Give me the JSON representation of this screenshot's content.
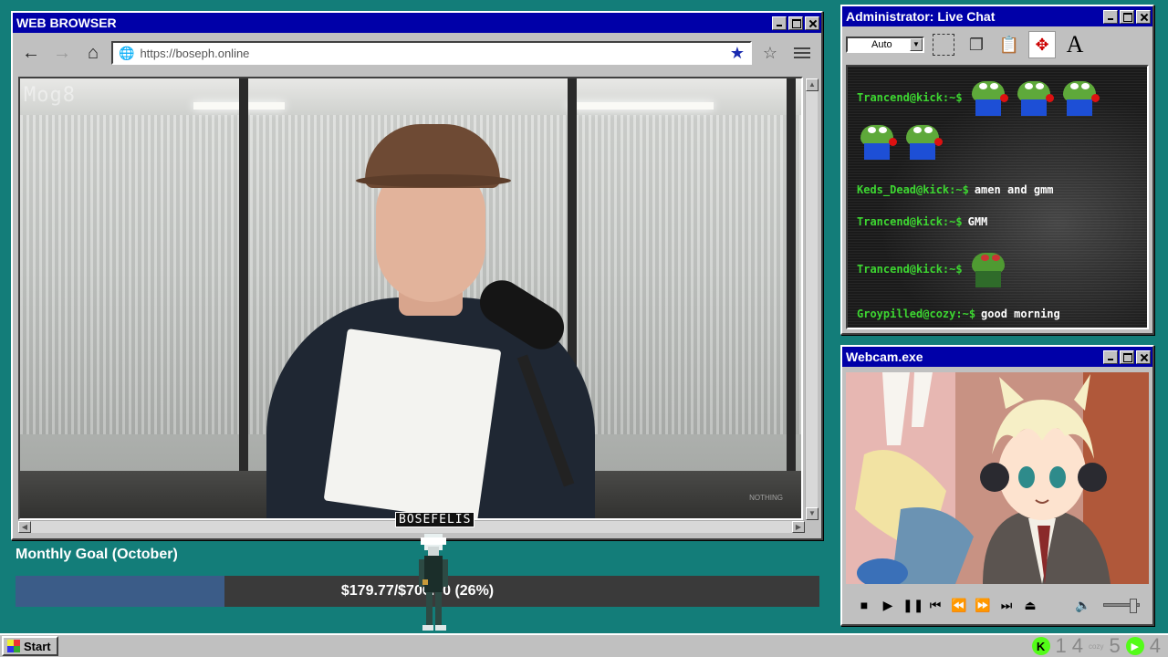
{
  "browser": {
    "title": "WEB BROWSER",
    "url": "https://boseph.online",
    "watermark": "Mog8",
    "corner_mark": "NOTHING"
  },
  "goal": {
    "title": "Monthly Goal (October)",
    "text": "$179.77/$700.00 (26%)",
    "progress_fraction": 0.26
  },
  "sprite": {
    "name": "BOSEFELIS"
  },
  "chat": {
    "title": "Administrator: Live Chat",
    "auto_label": "Auto",
    "messages": [
      {
        "user": "Trancend@kick:~$",
        "text": "",
        "emotes": 5
      },
      {
        "user": "Keds_Dead@kick:~$",
        "text": "amen and gmm",
        "emotes": 0
      },
      {
        "user": "Trancend@kick:~$",
        "text": "GMM",
        "emotes": 0
      },
      {
        "user": "Trancend@kick:~$",
        "text": "",
        "emotes": 1
      },
      {
        "user": "Groypilled@cozy:~$",
        "text": "good morning",
        "emotes": 0
      }
    ]
  },
  "webcam": {
    "title": "Webcam.exe"
  },
  "taskbar": {
    "start_label": "Start",
    "tray": [
      "1",
      "4",
      "cozy",
      "5",
      "4"
    ]
  },
  "colors": {
    "desktop": "#137d79",
    "titlebar": "#0000a8",
    "chat_user": "#3dd631",
    "goal_fill": "#3b5c88",
    "kick_green": "#53fc18"
  }
}
